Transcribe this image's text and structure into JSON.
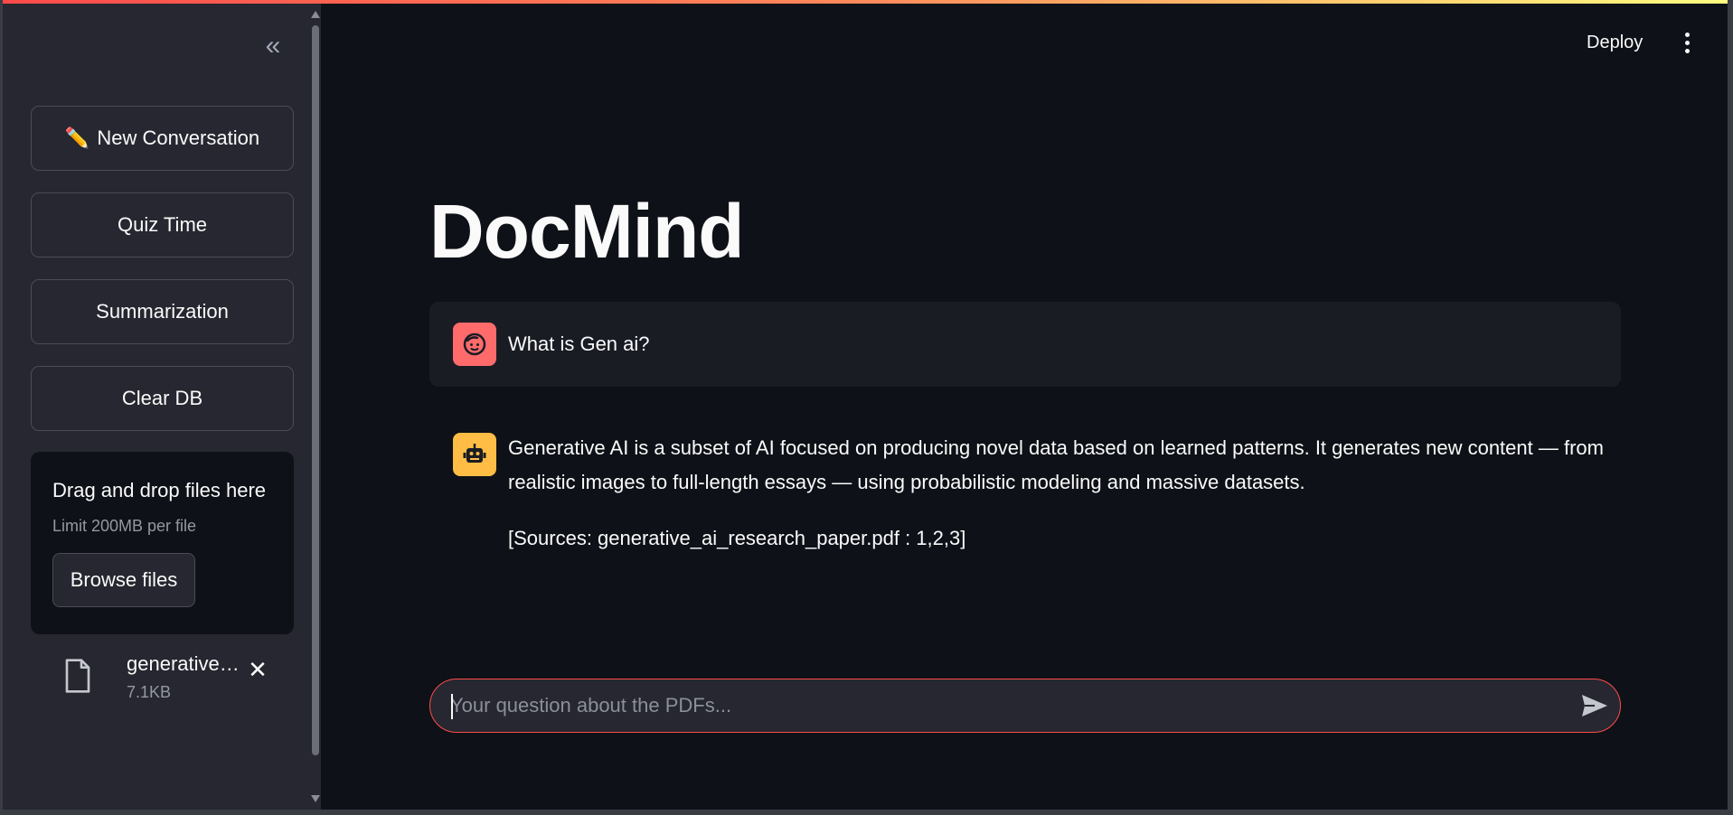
{
  "sidebar": {
    "collapse_label": "«",
    "buttons": {
      "new_conversation": "New Conversation",
      "quiz_time": "Quiz Time",
      "summarization": "Summarization",
      "clear_db": "Clear DB"
    },
    "uploader": {
      "title": "Drag and drop files here",
      "limit": "Limit 200MB per file",
      "browse_label": "Browse files"
    },
    "file": {
      "name": "generative_ai_research_paper.pdf",
      "size": "7.1KB"
    }
  },
  "header": {
    "deploy_label": "Deploy"
  },
  "main": {
    "title": "DocMind",
    "messages": {
      "user": {
        "text": "What is Gen ai?",
        "avatar_color": "#ff6b6b"
      },
      "assistant": {
        "line1": "Generative AI is a subset of AI focused on producing novel data based on learned patterns. It generates new content — from",
        "line2": "realistic images to full-length essays — using probabilistic modeling and massive datasets.",
        "sources": "[Sources: generative_ai_research_paper.pdf : 1,2,3]",
        "avatar_color": "#ffbd45"
      }
    },
    "chat_input": {
      "placeholder": "Your question about the PDFs...",
      "value": ""
    }
  },
  "colors": {
    "background": "#0e1117",
    "sidebar": "#262730",
    "accent": "#ff4b4b"
  }
}
